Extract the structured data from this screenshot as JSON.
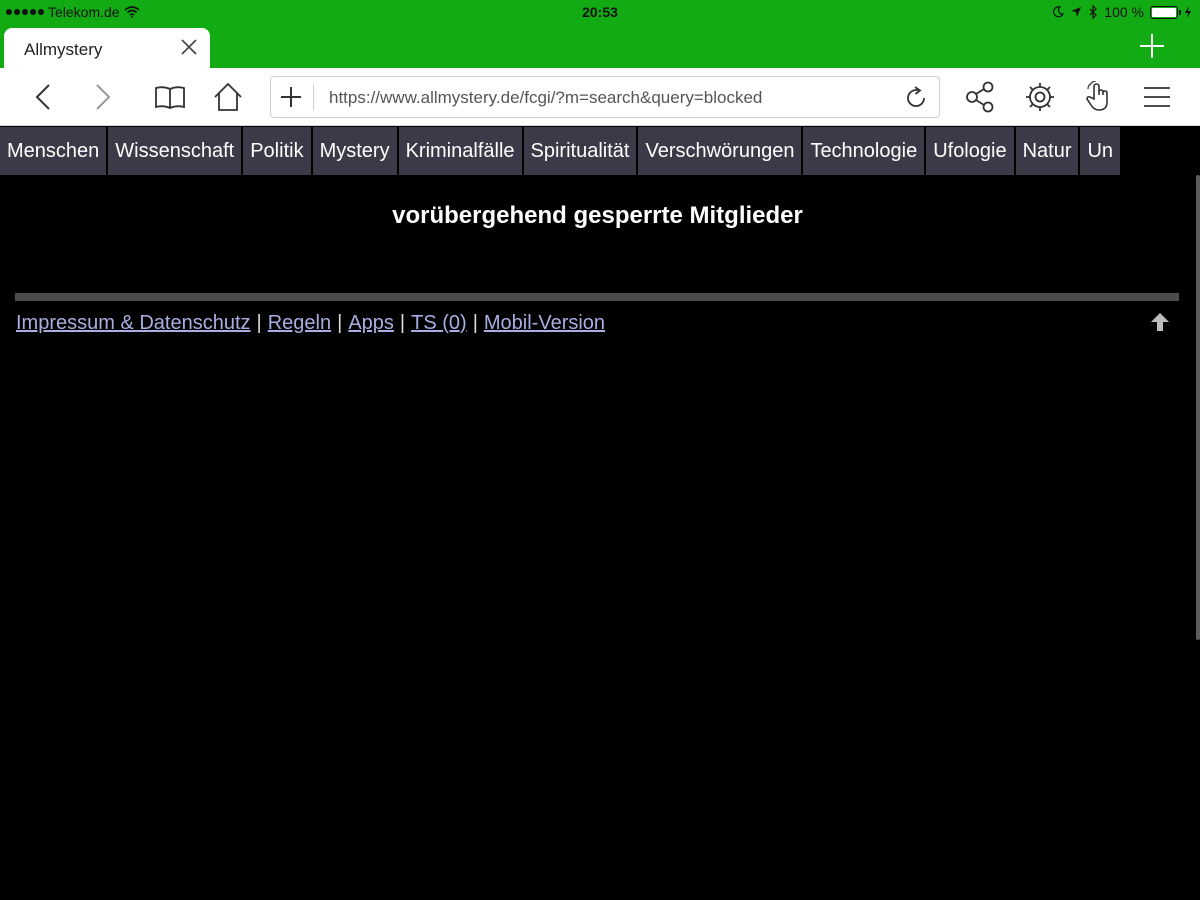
{
  "status_bar": {
    "carrier": "Telekom.de",
    "time": "20:53",
    "battery": "100 %",
    "battery_level": 1.0
  },
  "tab": {
    "title": "Allmystery"
  },
  "toolbar": {
    "url": "https://www.allmystery.de/fcgi/?m=search&query=blocked"
  },
  "icons": {
    "back": "chevron-left-icon",
    "forward": "chevron-right-icon",
    "bookmarks": "book-icon",
    "home": "home-icon",
    "share": "share-icon",
    "settings": "gear-icon",
    "gesture": "hand-pointer-icon",
    "menu": "hamburger-icon"
  },
  "categories": [
    "Menschen",
    "Wissenschaft",
    "Politik",
    "Mystery",
    "Kriminalfälle",
    "Spiritualität",
    "Verschwörungen",
    "Technologie",
    "Ufologie",
    "Natur",
    "Un"
  ],
  "main": {
    "heading": "vorübergehend gesperrte Mitglieder"
  },
  "footer": {
    "links": [
      "Impressum & Datenschutz",
      "Regeln",
      "Apps",
      "TS (0)",
      "Mobil-Version"
    ],
    "separator": "|"
  },
  "colors": {
    "browser_accent": "#13ab14",
    "nav_bg": "#3a3a48",
    "link": "#a9aee2",
    "page_bg": "#000000"
  }
}
